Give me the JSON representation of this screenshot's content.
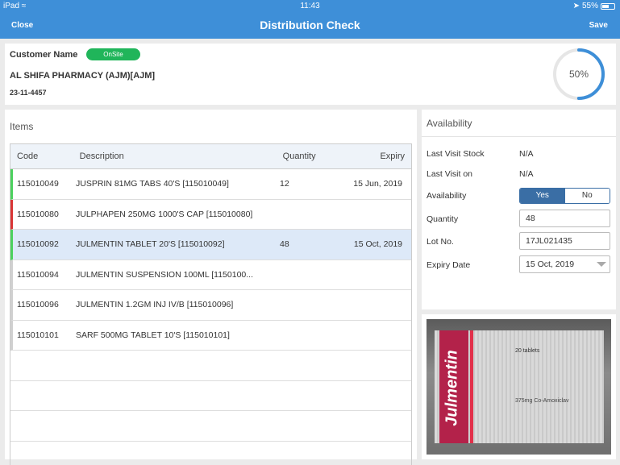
{
  "status": {
    "carrier": "iPad",
    "time": "11:43",
    "battery": "55%",
    "battery_level": 0.55
  },
  "nav": {
    "title": "Distribution Check",
    "close_label": "Close",
    "save_label": "Save"
  },
  "customer": {
    "label": "Customer Name",
    "badge": "OnSite",
    "name": "AL SHIFA PHARMACY (AJM)[AJM]",
    "id": "23-11-4457",
    "progress_text": "50%",
    "progress_value": 0.5
  },
  "items": {
    "title": "Items",
    "headers": {
      "code": "Code",
      "description": "Description",
      "quantity": "Quantity",
      "expiry": "Expiry"
    },
    "rows": [
      {
        "code": "115010049",
        "description": "JUSPRIN 81MG TABS 40'S [115010049]",
        "quantity": "12",
        "expiry": "15 Jun, 2019"
      },
      {
        "code": "115010080",
        "description": "JULPHAPEN 250MG 1000'S CAP [115010080]",
        "quantity": "",
        "expiry": ""
      },
      {
        "code": "115010092",
        "description": "JULMENTIN TABLET 20'S [115010092]",
        "quantity": "48",
        "expiry": "15 Oct, 2019"
      },
      {
        "code": "115010094",
        "description": "JULMENTIN SUSPENSION 100ML [1150100...",
        "quantity": "",
        "expiry": ""
      },
      {
        "code": "115010096",
        "description": "JULMENTIN 1.2GM INJ IV/B [115010096]",
        "quantity": "",
        "expiry": ""
      },
      {
        "code": "115010101",
        "description": "SARF 500MG TABLET 10'S [115010101]",
        "quantity": "",
        "expiry": ""
      }
    ]
  },
  "availability": {
    "title": "Availability",
    "last_visit_stock_label": "Last Visit Stock",
    "last_visit_stock_value": "N/A",
    "last_visit_on_label": "Last Visit on",
    "last_visit_on_value": "N/A",
    "availability_label": "Availability",
    "yes_label": "Yes",
    "no_label": "No",
    "quantity_label": "Quantity",
    "quantity_value": "48",
    "lot_label": "Lot No.",
    "lot_value": "17JL021435",
    "expiry_label": "Expiry Date",
    "expiry_value": "15 Oct, 2019"
  },
  "photo": {
    "brand": "Julmentin",
    "tag": "20 tablets",
    "dose": "375mg Co-Amoxiclav"
  },
  "colors": {
    "nav": "#3e8fd8",
    "onsite": "#20b55a",
    "gauge": "#3e8fd8",
    "selected_row": "#dde9f8",
    "toggle": "#3a6ea5"
  }
}
